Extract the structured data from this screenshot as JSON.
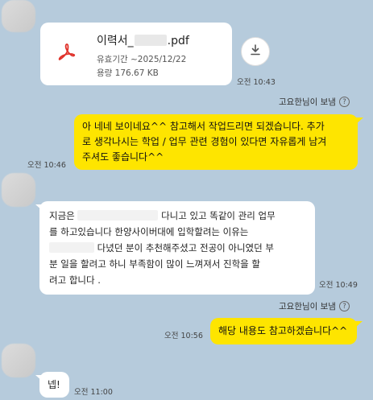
{
  "file": {
    "name_prefix": "이력서_",
    "name_suffix": ".pdf",
    "validity": "유효기간 ~2025/12/22",
    "size": "용량 176.67 KB",
    "time": "오전 10:43"
  },
  "messages": {
    "me1": {
      "sender": "고요한님이 보냄",
      "line1": "아 네네 보이네요^^ 참고해서 작업드리면 되겠습니다. 추가",
      "line2": "로 생각나시는 학업 / 업무 관련 경험이 있다면 자유롭게 남겨",
      "line3": "주셔도 좋습니다^^",
      "time": "오전 10:46"
    },
    "other1": {
      "line1_a": "지금은",
      "line1_b": "다니고 있고 똑같이 관리 업무",
      "line2": "를 하고있습니다 한양사이버대에 입학할려는 이유는",
      "line3_b": "다녔던 분이 추천해주셨고 전공이 아니였던 부",
      "line4": "분 일을 할려고 하니 부족함이 많이 느껴져서 진학을 할",
      "line5": "려고 합니다 .",
      "time": "오전 10:49"
    },
    "me2": {
      "sender": "고요한님이 보냄",
      "text": "해당 내용도 참고하겠습니다^^",
      "time": "오전 10:56"
    },
    "other2": {
      "text": "넵!",
      "time": "오전 11:00"
    }
  },
  "icons": {
    "pdf": "pdf-acrobat-icon",
    "download": "download-icon",
    "help": "question-circle-icon"
  },
  "help_glyph": "?",
  "colors": {
    "background": "#b6cbdc",
    "my_bubble": "#fee500",
    "other_bubble": "#ffffff",
    "pdf_red": "#e0312a"
  }
}
